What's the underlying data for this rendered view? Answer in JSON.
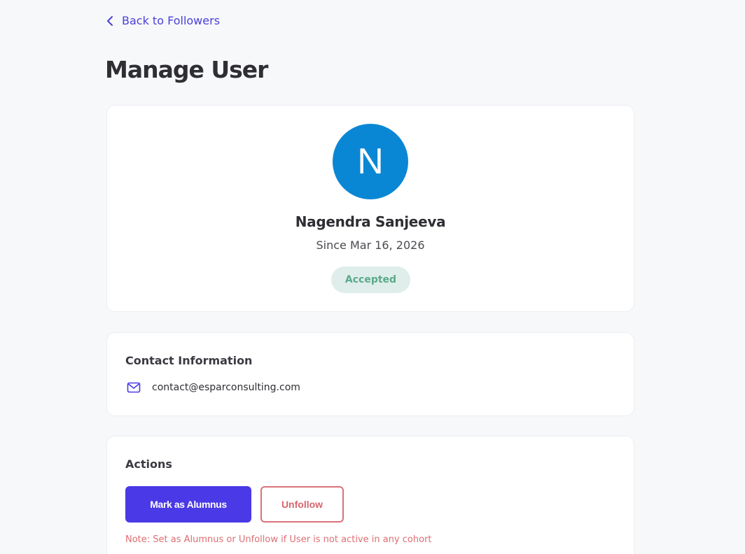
{
  "nav": {
    "back_label": "Back to Followers"
  },
  "page": {
    "title": "Manage User"
  },
  "profile": {
    "avatar_initial": "N",
    "name": "Nagendra Sanjeeva",
    "since": "Since Mar 16, 2026",
    "status": "Accepted"
  },
  "contact": {
    "title": "Contact Information",
    "email": "contact@esparconsulting.com",
    "email_icon": "mail-icon"
  },
  "actions": {
    "title": "Actions",
    "primary_label": "Mark as Alumnus",
    "secondary_label": "Unfollow",
    "note": "Note: Set as Alumnus or Unfollow if User is not active in any cohort"
  },
  "colors": {
    "accent": "#4a39e6",
    "avatar": "#0a87d4",
    "status_bg": "#dfeeea",
    "status_text": "#5aa98b",
    "danger": "#d9646a"
  }
}
